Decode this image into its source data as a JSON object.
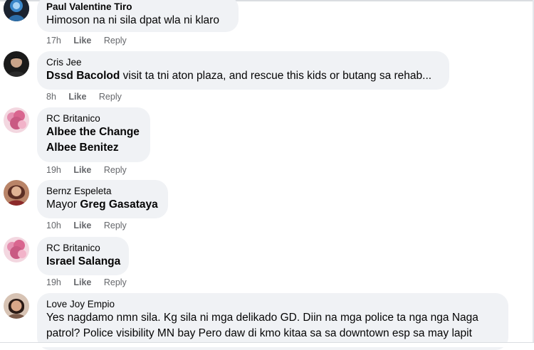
{
  "comments": [
    {
      "author": "Paul Valentine Tiro",
      "segments": [
        {
          "text": "Himoson na ni sila dpat wla ni klaro",
          "bold": false
        }
      ],
      "time": "17h",
      "like": "Like",
      "reply": "Reply"
    },
    {
      "author": "Cris Jee",
      "segments": [
        {
          "text": "Dssd Bacolod",
          "bold": true
        },
        {
          "text": " visit ta tni aton plaza, and rescue this kids or butang sa rehab...",
          "bold": false
        }
      ],
      "time": "8h",
      "like": "Like",
      "reply": "Reply"
    },
    {
      "author": "RC Britanico",
      "line1": "Albee the Change",
      "line2": "Albee Benitez",
      "time": "19h",
      "like": "Like",
      "reply": "Reply"
    },
    {
      "author": "Bernz Espeleta",
      "prefix": "Mayor ",
      "tag": "Greg Gasataya",
      "time": "10h",
      "like": "Like",
      "reply": "Reply"
    },
    {
      "author": "RC Britanico",
      "tag": "Israel Salanga",
      "time": "19h",
      "like": "Like",
      "reply": "Reply"
    },
    {
      "author": "Love Joy Empio",
      "line1": "Yes nagdamo nmn sila. Kg sila ni mga delikado GD. Diin na mga police ta nga nga Naga",
      "line2": "patrol? Police visibility MN bay Pero daw di kmo kitaa sa sa downtown esp sa may lapit"
    }
  ],
  "colors": {
    "bubble": "#f0f2f5",
    "meta": "#65676b",
    "text": "#050505"
  },
  "icons": [
    "avatar-photo"
  ]
}
